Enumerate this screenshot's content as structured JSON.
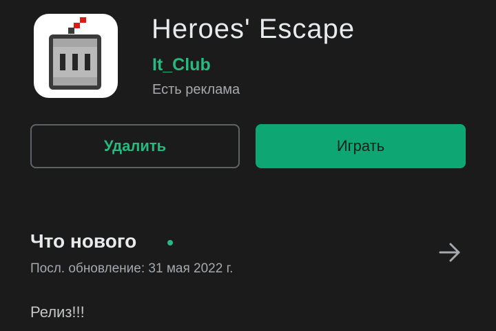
{
  "app": {
    "title": "Heroes' Escape",
    "developer": "It_Club",
    "ads_notice": "Есть реклама",
    "icon": "knight-helmet-icon"
  },
  "actions": {
    "uninstall_label": "Удалить",
    "play_label": "Играть"
  },
  "whats_new": {
    "title": "Что нового",
    "last_update": "Посл. обновление: 31 мая 2022 г.",
    "notes": "Релиз!!!",
    "arrow_icon": "arrow-right-icon"
  },
  "colors": {
    "background": "#1b1b1b",
    "accent": "#27b97f",
    "play_button": "#0ea773"
  }
}
